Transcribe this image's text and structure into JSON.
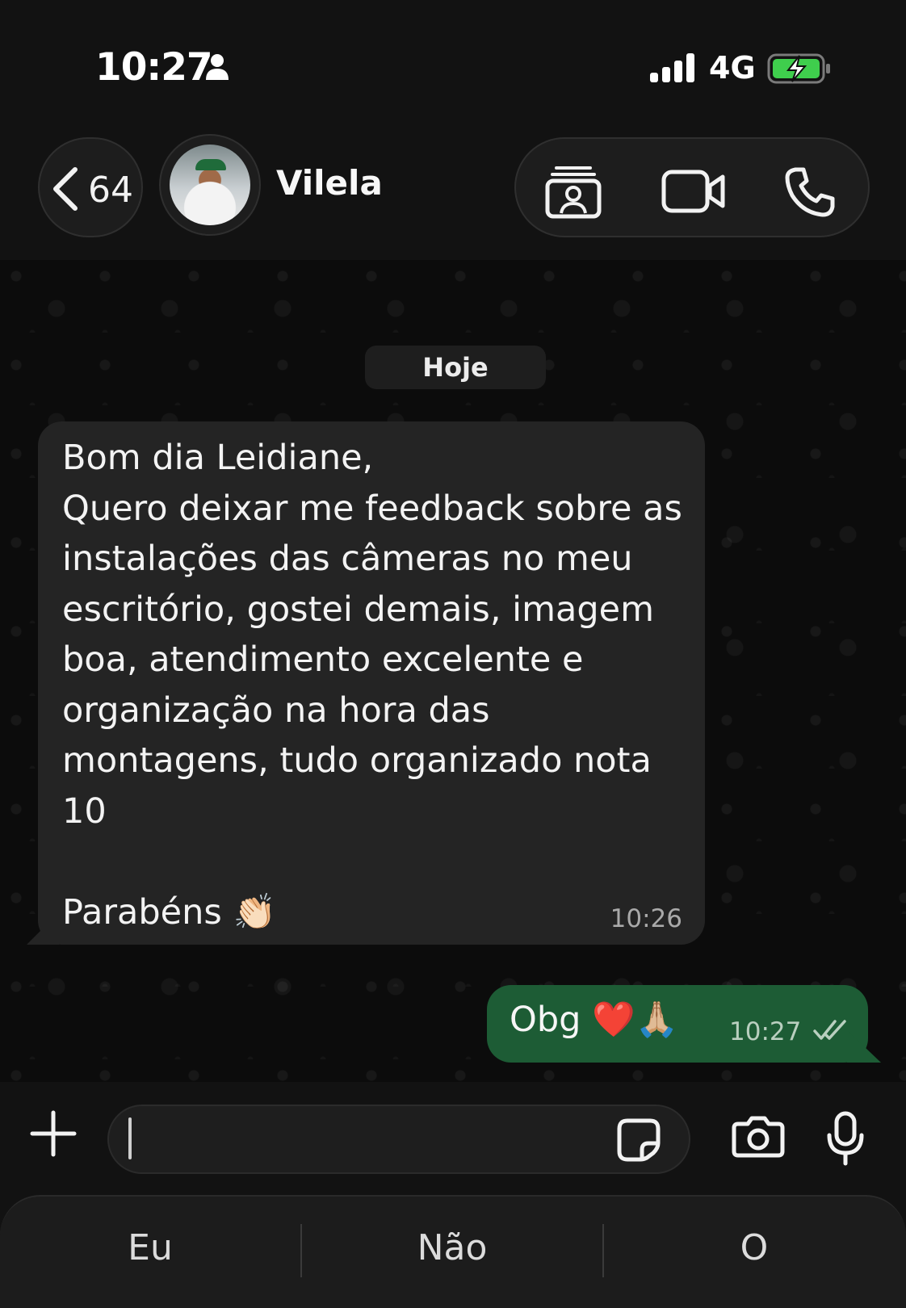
{
  "status_bar": {
    "time": "10:27",
    "network": "4G",
    "battery_state": "charging"
  },
  "header": {
    "back_count": "64",
    "contact_name": "Vilela",
    "icons": [
      "contact-card-icon",
      "video-call-icon",
      "phone-icon"
    ]
  },
  "chat": {
    "date_label": "Hoje",
    "messages": [
      {
        "direction": "incoming",
        "text": "Bom dia Leidiane,\nQuero deixar me feedback sobre as instalações das câmeras no meu escritório, gostei demais, imagem boa, atendimento excelente e organização na hora das montagens, tudo organizado nota 10\n\nParabéns 👏🏻",
        "time": "10:26"
      },
      {
        "direction": "outgoing",
        "text": "Obg ❤️🙏🏼",
        "time": "10:27",
        "status": "read"
      }
    ]
  },
  "input": {
    "value": ""
  },
  "keyboard": {
    "suggestions": [
      "Eu",
      "Não",
      "O"
    ]
  },
  "colors": {
    "incoming_bubble": "#242424",
    "outgoing_bubble": "#1d5c35",
    "background": "#0c0c0c"
  }
}
